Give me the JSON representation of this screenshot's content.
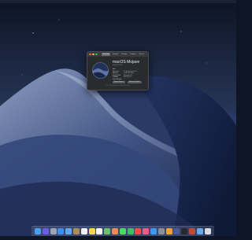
{
  "about": {
    "tabs": [
      "Overview",
      "Displays",
      "Storage",
      "Support",
      "Service"
    ],
    "os_name": "macOS Mojave",
    "version": "Version 10.14",
    "specs": [
      {
        "label": "iMac",
        "value": ""
      },
      {
        "label": "Processor",
        "value": "3.1 GHz Intel Core i5"
      },
      {
        "label": "Memory",
        "value": "8 GB 1867 MHz"
      },
      {
        "label": "Startup Disk",
        "value": "Macintosh HD"
      },
      {
        "label": "Graphics",
        "value": "Intel Iris Pro"
      },
      {
        "label": "Serial Number",
        "value": ""
      }
    ],
    "buttons": [
      "System Report...",
      "Software Update..."
    ],
    "copyright": "™ and © 1983-2018 Apple Inc. All Rights Reserved."
  },
  "colors": {
    "close": "#ff5f57",
    "minimize": "#febc2e",
    "zoom": "#28c840",
    "sky": "#2a3a5e",
    "dune": "#1c2b4f"
  },
  "dock": [
    {
      "name": "finder-icon",
      "color": "#4aa0f0"
    },
    {
      "name": "siri-icon",
      "color": "#6b5be6"
    },
    {
      "name": "launchpad-icon",
      "color": "#9aa4b4"
    },
    {
      "name": "safari-icon",
      "color": "#3a8ef0"
    },
    {
      "name": "mail-icon",
      "color": "#5ea8f0"
    },
    {
      "name": "contacts-icon",
      "color": "#b08a5a"
    },
    {
      "name": "calendar-icon",
      "color": "#f0f0f0"
    },
    {
      "name": "notes-icon",
      "color": "#f6d54a"
    },
    {
      "name": "reminders-icon",
      "color": "#f4f4f4"
    },
    {
      "name": "maps-icon",
      "color": "#6cc070"
    },
    {
      "name": "photos-icon",
      "color": "#f08a5a"
    },
    {
      "name": "messages-icon",
      "color": "#4cd964"
    },
    {
      "name": "facetime-icon",
      "color": "#3cc060"
    },
    {
      "name": "news-icon",
      "color": "#f04a4a"
    },
    {
      "name": "music-icon",
      "color": "#f05a8a"
    },
    {
      "name": "app-store-icon",
      "color": "#3a9af0"
    },
    {
      "name": "system-preferences-icon",
      "color": "#8a8e96"
    },
    {
      "name": "sketch-icon",
      "color": "#f0a030"
    },
    {
      "name": "app-icon",
      "color": "#4a5a9a"
    },
    {
      "name": "terminal-icon",
      "color": "#2a2a2a"
    },
    {
      "name": "app-icon-2",
      "color": "#c04a3a"
    },
    {
      "name": "documents-folder-icon",
      "color": "#6aa8e8"
    },
    {
      "name": "trash-icon",
      "color": "#d8dce2"
    }
  ]
}
